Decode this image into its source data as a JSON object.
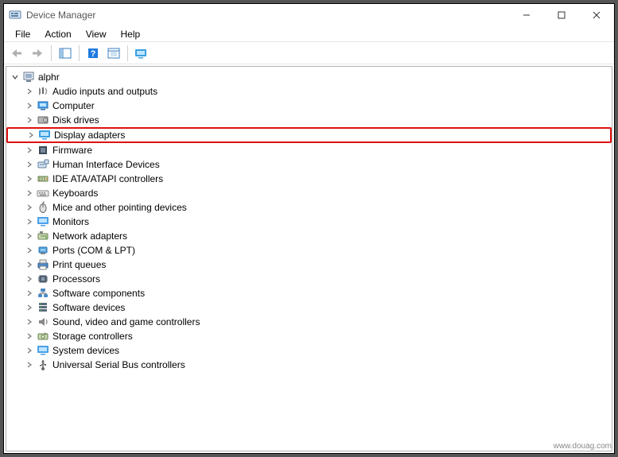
{
  "window": {
    "title": "Device Manager"
  },
  "menu": {
    "items": [
      "File",
      "Action",
      "View",
      "Help"
    ]
  },
  "tree": {
    "root": {
      "label": "alphr",
      "expanded": true
    },
    "nodes": [
      {
        "label": "Audio inputs and outputs",
        "icon": "audio"
      },
      {
        "label": "Computer",
        "icon": "computer"
      },
      {
        "label": "Disk drives",
        "icon": "disk"
      },
      {
        "label": "Display adapters",
        "icon": "display",
        "highlighted": true
      },
      {
        "label": "Firmware",
        "icon": "firmware"
      },
      {
        "label": "Human Interface Devices",
        "icon": "hid"
      },
      {
        "label": "IDE ATA/ATAPI controllers",
        "icon": "ide"
      },
      {
        "label": "Keyboards",
        "icon": "keyboard"
      },
      {
        "label": "Mice and other pointing devices",
        "icon": "mouse"
      },
      {
        "label": "Monitors",
        "icon": "monitor"
      },
      {
        "label": "Network adapters",
        "icon": "network"
      },
      {
        "label": "Ports (COM & LPT)",
        "icon": "port"
      },
      {
        "label": "Print queues",
        "icon": "printer"
      },
      {
        "label": "Processors",
        "icon": "cpu"
      },
      {
        "label": "Software components",
        "icon": "swcomp"
      },
      {
        "label": "Software devices",
        "icon": "swdev"
      },
      {
        "label": "Sound, video and game controllers",
        "icon": "sound"
      },
      {
        "label": "Storage controllers",
        "icon": "storage"
      },
      {
        "label": "System devices",
        "icon": "system"
      },
      {
        "label": "Universal Serial Bus controllers",
        "icon": "usb"
      }
    ]
  },
  "watermark": "www.douag.com"
}
